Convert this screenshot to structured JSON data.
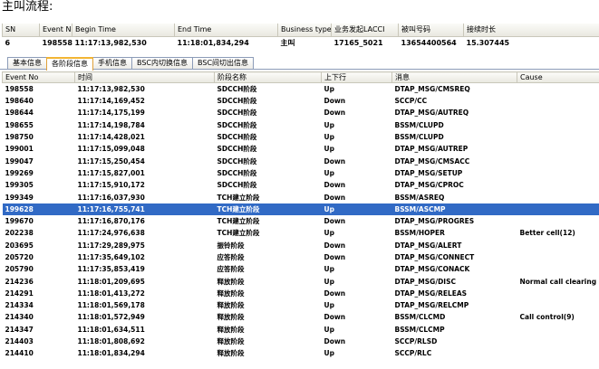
{
  "page_title": "主叫流程:",
  "call_summary": {
    "headers": [
      "SN",
      "Event No",
      "Begin Time",
      "End Time",
      "Business type",
      "业务发起LACCI",
      "被叫号码",
      "接续时长"
    ],
    "row": [
      "6",
      "198558",
      "11:17:13,982,530",
      "11:18:01,834,294",
      "主叫",
      "17165_5021",
      "13654400564",
      "15.307445"
    ]
  },
  "tabs": [
    {
      "label": "基本信息",
      "active": false
    },
    {
      "label": "各阶段信息",
      "active": true
    },
    {
      "label": "手机信息",
      "active": false
    },
    {
      "label": "BSC内切换信息",
      "active": false
    },
    {
      "label": "BSC间切出信息",
      "active": false
    }
  ],
  "events": {
    "headers": [
      "Event No",
      "时间",
      "阶段名称",
      "上下行",
      "消息",
      "Cause"
    ],
    "selected_row": 12,
    "rows": [
      [
        "198558",
        "11:17:13,982,530",
        "SDCCH阶段",
        "Up",
        "DTAP_MSG/CMSREQ",
        ""
      ],
      [
        "198640",
        "11:17:14,169,452",
        "SDCCH阶段",
        "Down",
        "SCCP/CC",
        ""
      ],
      [
        "198644",
        "11:17:14,175,199",
        "SDCCH阶段",
        "Down",
        "DTAP_MSG/AUTREQ",
        ""
      ],
      [
        "198655",
        "11:17:14,198,784",
        "SDCCH阶段",
        "Up",
        "BSSM/CLUPD",
        ""
      ],
      [
        "198750",
        "11:17:14,428,021",
        "SDCCH阶段",
        "Up",
        "BSSM/CLUPD",
        ""
      ],
      [
        "199001",
        "11:17:15,099,048",
        "SDCCH阶段",
        "Up",
        "DTAP_MSG/AUTREP",
        ""
      ],
      [
        "199047",
        "11:17:15,250,454",
        "SDCCH阶段",
        "Down",
        "DTAP_MSG/CMSACC",
        ""
      ],
      [
        "199269",
        "11:17:15,827,001",
        "SDCCH阶段",
        "Up",
        "DTAP_MSG/SETUP",
        ""
      ],
      [
        "199305",
        "11:17:15,910,172",
        "SDCCH阶段",
        "Down",
        "DTAP_MSG/CPROC",
        ""
      ],
      [
        "199349",
        "11:17:16,037,930",
        "TCH建立阶段",
        "Down",
        "BSSM/ASREQ",
        ""
      ],
      [
        "199628",
        "11:17:16,755,741",
        "TCH建立阶段",
        "Up",
        "BSSM/ASCMP",
        ""
      ],
      [
        "199670",
        "11:17:16,870,176",
        "TCH建立阶段",
        "Down",
        "DTAP_MSG/PROGRES",
        ""
      ],
      [
        "202238",
        "11:17:24,976,638",
        "TCH建立阶段",
        "Up",
        "BSSM/HOPER",
        "Better cell(12)"
      ],
      [
        "203695",
        "11:17:29,289,975",
        "振铃阶段",
        "Down",
        "DTAP_MSG/ALERT",
        ""
      ],
      [
        "205720",
        "11:17:35,649,102",
        "应答阶段",
        "Down",
        "DTAP_MSG/CONNECT",
        ""
      ],
      [
        "205790",
        "11:17:35,853,419",
        "应答阶段",
        "Up",
        "DTAP_MSG/CONACK",
        ""
      ],
      [
        "214236",
        "11:18:01,209,695",
        "释放阶段",
        "Up",
        "DTAP_MSG/DISC",
        "Normal call clearing"
      ],
      [
        "214291",
        "11:18:01,413,272",
        "释放阶段",
        "Down",
        "DTAP_MSG/RELEAS",
        ""
      ],
      [
        "214334",
        "11:18:01,569,178",
        "释放阶段",
        "Up",
        "DTAP_MSG/RELCMP",
        ""
      ],
      [
        "214340",
        "11:18:01,572,949",
        "释放阶段",
        "Down",
        "BSSM/CLCMD",
        "Call control(9)"
      ],
      [
        "214347",
        "11:18:01,634,511",
        "释放阶段",
        "Up",
        "BSSM/CLCMP",
        ""
      ],
      [
        "214403",
        "11:18:01,808,692",
        "释放阶段",
        "Down",
        "SCCP/RLSD",
        ""
      ],
      [
        "214410",
        "11:18:01,834,294",
        "释放阶段",
        "Up",
        "SCCP/RLC",
        ""
      ]
    ]
  }
}
